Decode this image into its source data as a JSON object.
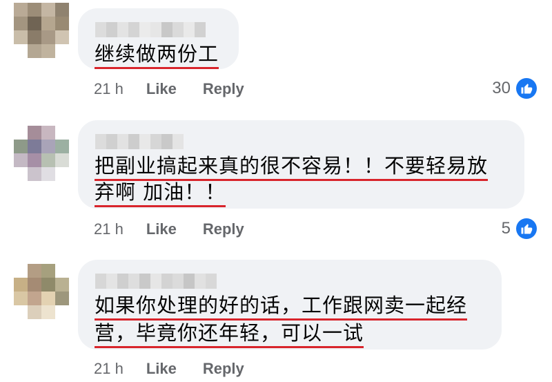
{
  "comments": [
    {
      "text_lines": [
        "继续做两份工"
      ],
      "time": "21 h",
      "like_label": "Like",
      "reply_label": "Reply",
      "reaction_count": "30"
    },
    {
      "text_lines": [
        "把副业搞起来真的很不容易！！不要轻易放",
        "弃啊 加油！！"
      ],
      "time": "21 h",
      "like_label": "Like",
      "reply_label": "Reply",
      "reaction_count": "5"
    },
    {
      "text_lines": [
        "如果你处理的好的话，工作跟网卖一起经",
        "营，毕竟你还年轻，可以一试"
      ],
      "time": "21 h",
      "like_label": "Like",
      "reply_label": "Reply"
    }
  ],
  "colors": {
    "bubble": "#f0f2f5",
    "underline": "#d8242b",
    "like_blue": "#1877f2",
    "meta_text": "#65676b"
  },
  "icons": {
    "reaction": "thumbs-up-icon"
  }
}
